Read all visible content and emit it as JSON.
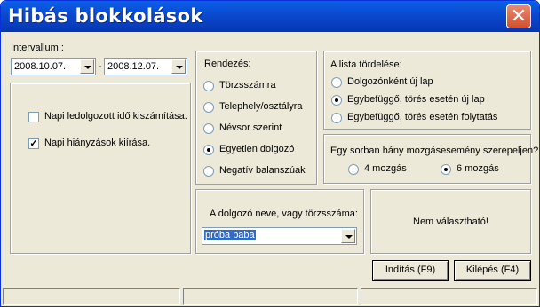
{
  "window": {
    "title": "Hibás blokkolások",
    "close_symbol": "✕"
  },
  "interval": {
    "label": "Intervallum :",
    "from": "2008.10.07.",
    "separator": "-",
    "to": "2008.12.07."
  },
  "options": {
    "items": [
      {
        "label": "Napi ledolgozott idő kiszámítása.",
        "checked": false
      },
      {
        "label": "Napi hiányzások kiírása.",
        "checked": true
      }
    ]
  },
  "sort": {
    "title": "Rendezés:",
    "items": [
      {
        "label": "Törzsszámra",
        "selected": false
      },
      {
        "label": "Telephely/osztályra",
        "selected": false
      },
      {
        "label": "Névsor szerint",
        "selected": false
      },
      {
        "label": "Egyetlen dolgozó",
        "selected": true
      },
      {
        "label": "Negatív balanszúak",
        "selected": false
      }
    ]
  },
  "paging": {
    "title": "A lista tördelése:",
    "items": [
      {
        "label": "Dolgozónként új lap",
        "selected": false
      },
      {
        "label": "Egybefüggő, törés esetén új lap",
        "selected": true
      },
      {
        "label": "Egybefüggő, törés esetén folytatás",
        "selected": false
      }
    ]
  },
  "events": {
    "question": "Egy sorban hány mozgásesemény szerepeljen?",
    "items": [
      {
        "label": "4 mozgás",
        "selected": false
      },
      {
        "label": "6 mozgás",
        "selected": true
      }
    ]
  },
  "employee": {
    "label": "A dolgozó neve, vagy törzsszáma:",
    "value": "próba baba"
  },
  "not_selectable": {
    "text": "Nem választható!"
  },
  "buttons": {
    "start": "Indítás (F9)",
    "exit": "Kilépés (F4)"
  }
}
